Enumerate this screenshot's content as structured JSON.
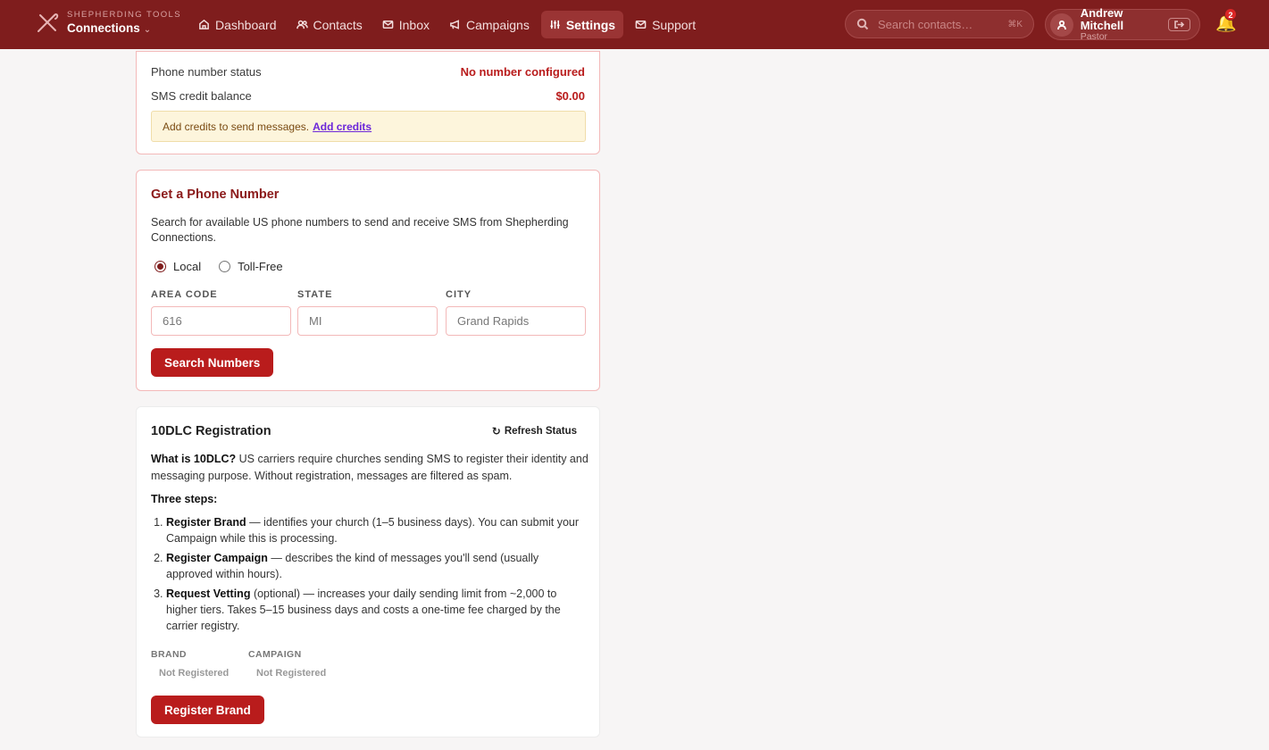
{
  "header": {
    "brand_sub": "SHEPHERDING TOOLS",
    "brand_main": "Connections",
    "nav": [
      {
        "label": "Dashboard",
        "icon": "home-icon"
      },
      {
        "label": "Contacts",
        "icon": "users-icon"
      },
      {
        "label": "Inbox",
        "icon": "mail-icon"
      },
      {
        "label": "Campaigns",
        "icon": "megaphone-icon"
      },
      {
        "label": "Settings",
        "icon": "sliders-icon",
        "active": true
      },
      {
        "label": "Support",
        "icon": "envelope-icon"
      }
    ],
    "search_placeholder": "Search contacts…",
    "search_shortcut": "⌘K",
    "user_name": "Andrew Mitchell",
    "user_role": "Pastor",
    "notification_count": "2"
  },
  "sms_status": {
    "phone_label": "Phone number status",
    "phone_value": "No number configured",
    "credit_label": "SMS credit balance",
    "credit_value": "$0.00",
    "notice_text": "Add credits to send messages.",
    "notice_link": "Add credits"
  },
  "phone_number": {
    "title": "Get a Phone Number",
    "description": "Search for available US phone numbers to send and receive SMS from Shepherding Connections.",
    "radio_local": "Local",
    "radio_tollfree": "Toll-Free",
    "area_code_label": "AREA CODE",
    "area_code_placeholder": "616",
    "state_label": "STATE",
    "state_placeholder": "MI",
    "city_label": "CITY",
    "city_placeholder": "Grand Rapids",
    "search_button": "Search Numbers"
  },
  "registration": {
    "title": "10DLC Registration",
    "refresh_label": "Refresh Status",
    "what_is_label": "What is 10DLC?",
    "what_is_text": " US carriers require churches sending SMS to register their identity and messaging purpose. Without registration, messages are filtered as spam.",
    "three_steps_label": "Three steps:",
    "steps": [
      {
        "title": "Register Brand",
        "text": " — identifies your church (1–5 business days). You can submit your Campaign while this is processing."
      },
      {
        "title": "Register Campaign",
        "text": " — describes the kind of messages you'll send (usually approved within hours)."
      },
      {
        "title": "Request Vetting",
        "text": " (optional) — increases your daily sending limit from ~2,000 to higher tiers. Takes 5–15 business days and costs a one-time fee charged by the carrier registry."
      }
    ],
    "brand_label": "BRAND",
    "brand_value": "Not Registered",
    "campaign_label": "CAMPAIGN",
    "campaign_value": "Not Registered",
    "register_button": "Register Brand"
  }
}
